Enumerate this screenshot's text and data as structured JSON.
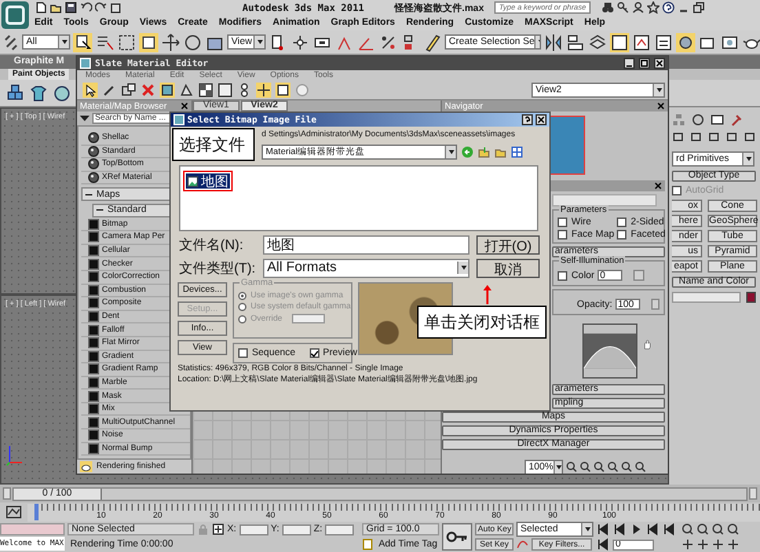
{
  "app": {
    "title": "Autodesk 3ds Max  2011",
    "file": "怪怪海盗散文件.max",
    "search": {
      "placeholder": "Type a keyword or phrase"
    }
  },
  "menu": [
    "Edit",
    "Tools",
    "Group",
    "Views",
    "Create",
    "Modifiers",
    "Animation",
    "Graph Editors",
    "Rendering",
    "Customize",
    "MAXScript",
    "Help"
  ],
  "toolbar": {
    "filter": "All",
    "coord": "View",
    "selection_set": "Create Selection Se"
  },
  "ribbon": {
    "title": "Graphite M",
    "tab": "Paint Objects"
  },
  "viewports": [
    {
      "label": "[ + ] [ Top ] [ Wiref"
    },
    {
      "label": "[ + ] [ Left ] [ Wiref"
    }
  ],
  "command_panel": {
    "category": "rd Primitives",
    "object_type": "Object Type",
    "autogrid": {
      "label": "AutoGrid",
      "checked": false
    },
    "buttons": [
      "ox",
      "Cone",
      "here",
      "GeoSphere",
      "nder",
      "Tube",
      "us",
      "Pyramid",
      "eapot",
      "Plane"
    ],
    "name_color": "Name and Color"
  },
  "slate": {
    "title": "Slate Material Editor",
    "menu": [
      "Modes",
      "Material",
      "Edit",
      "Select",
      "View",
      "Options",
      "Tools"
    ],
    "view_select": "View2",
    "browser": {
      "title": "Material/Map Browser",
      "search": {
        "placeholder": "Search by Name ..."
      },
      "materials": [
        "Shellac",
        "Standard",
        "Top/Bottom",
        "XRef Material"
      ],
      "groups": [
        {
          "label": "Maps",
          "expanded": true,
          "children": [
            {
              "label": "Standard",
              "expanded": true,
              "children": [
                "Bitmap",
                "Camera Map Per",
                "Cellular",
                "Checker",
                "ColorCorrection",
                "Combustion",
                "Composite",
                "Dent",
                "Falloff",
                "Flat Mirror",
                "Gradient",
                "Gradient Ramp",
                "Marble",
                "Mask",
                "Mix",
                "MultiOutputChannel",
                "Noise",
                "Normal Bump"
              ]
            }
          ]
        }
      ]
    },
    "view_tabs": [
      {
        "label": "View1",
        "selected": false
      },
      {
        "label": "View2",
        "selected": true
      }
    ],
    "navigator": {
      "title": "Navigator"
    },
    "params": {
      "basic": {
        "title": "Parameters",
        "checks": [
          {
            "label": "Wire",
            "checked": false
          },
          {
            "label": "2-Sided",
            "checked": false
          },
          {
            "label": "Face Map",
            "checked": false
          },
          {
            "label": "Faceted",
            "checked": false
          }
        ]
      },
      "shader_title": "arameters",
      "self_illum": {
        "title": "Self-Illumination",
        "color": {
          "label": "Color",
          "checked": false
        },
        "value": "0"
      },
      "opacity": {
        "label": "Opacity:",
        "value": "100"
      },
      "rollouts": [
        {
          "label": "arameters",
          "cut": true
        },
        {
          "label": "mpling",
          "cut": true
        },
        {
          "label": "Maps",
          "cut": false
        },
        {
          "label": "Dynamics Properties",
          "cut": false
        },
        {
          "label": "DirectX Manager",
          "cut": false
        }
      ]
    },
    "zoom": "100%",
    "status": "Rendering finished"
  },
  "dialog": {
    "title": "Select Bitmap Image File",
    "path": "d Settings\\Administrator\\My Documents\\3dsMax\\sceneassets\\images",
    "look_in": "Material编辑器附带光盘",
    "files": [
      {
        "name": "地图",
        "selected": true
      }
    ],
    "file_name": {
      "label": "文件名(N):",
      "value": "地图"
    },
    "file_type": {
      "label": "文件类型(T):",
      "value": "All Formats"
    },
    "open": "打开(O)",
    "cancel": "取消",
    "buttons": [
      {
        "label": "Devices...",
        "disabled": false
      },
      {
        "label": "Setup...",
        "disabled": true
      },
      {
        "label": "Info...",
        "disabled": false
      },
      {
        "label": "View",
        "disabled": false
      }
    ],
    "gamma": {
      "title": "Gamma",
      "disabled": true,
      "options": [
        {
          "label": "Use image's own gamma",
          "selected": true
        },
        {
          "label": "Use system default gamma",
          "selected": false
        },
        {
          "label": "Override",
          "selected": false
        }
      ]
    },
    "sequence": {
      "label": "Sequence",
      "checked": false
    },
    "preview": {
      "label": "Preview",
      "checked": true
    },
    "statistics": "Statistics: 496x379, RGB Color 8 Bits/Channel - Single Image",
    "location": "Location: D:\\网上文稿\\Slate Material编辑器\\Slate Material编辑器附带光盘\\地图.jpg"
  },
  "callouts": [
    "选择文件",
    "单击关闭对话框"
  ],
  "timeline": {
    "frame": "0 / 100",
    "level": 0,
    "ticks": [
      "10",
      "20",
      "30",
      "40",
      "50",
      "60",
      "70",
      "80",
      "90",
      "100"
    ]
  },
  "status": {
    "prompt": "Welcome to MAX",
    "selection": "None Selected",
    "render_time": "Rendering Time  0:00:00",
    "coords": [
      "X:",
      "Y:",
      "Z:"
    ],
    "grid": "Grid = 100.0",
    "time_tag": "Add Time Tag",
    "auto_key": "Auto Key",
    "key_mode": "Selected",
    "set_key": "Set Key",
    "key_filters": "Key Filters...",
    "frame": "0"
  }
}
